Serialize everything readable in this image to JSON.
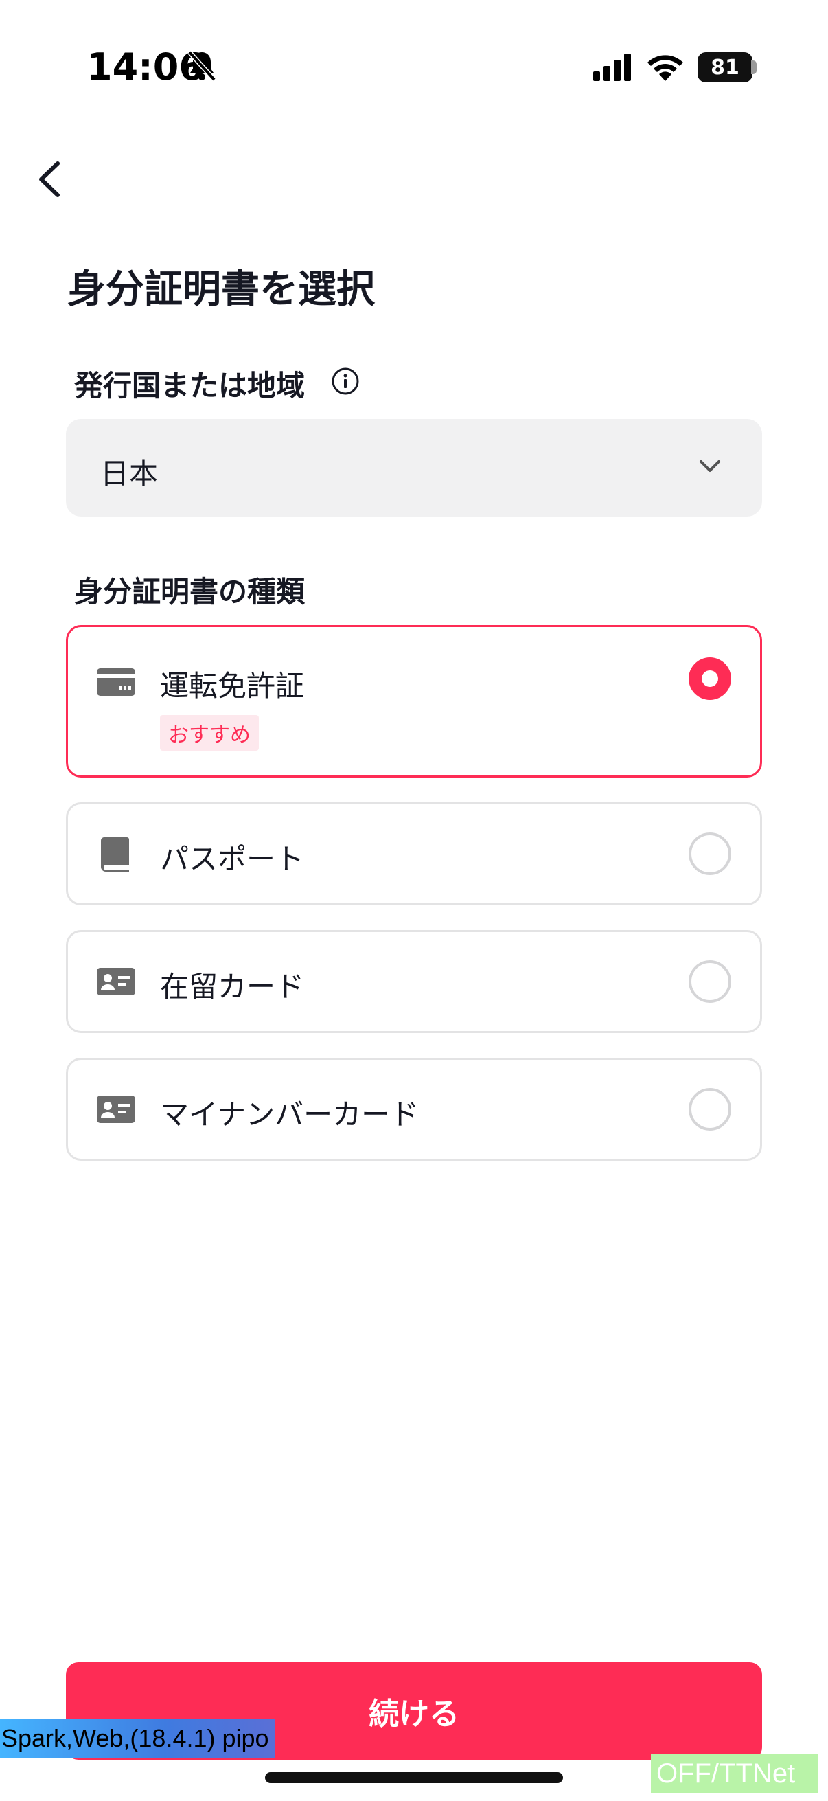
{
  "status_bar": {
    "time": "14:06",
    "battery": "81"
  },
  "page": {
    "title": "身分証明書を選択"
  },
  "country": {
    "label": "発行国または地域",
    "value": "日本"
  },
  "id_type": {
    "label": "身分証明書の種類",
    "options": [
      {
        "label": "運転免許証",
        "badge": "おすすめ",
        "icon": "id-card-icon",
        "selected": true
      },
      {
        "label": "パスポート",
        "icon": "passport-book-icon",
        "selected": false
      },
      {
        "label": "在留カード",
        "icon": "residence-card-icon",
        "selected": false
      },
      {
        "label": "マイナンバーカード",
        "icon": "my-number-card-icon",
        "selected": false
      }
    ]
  },
  "actions": {
    "continue_label": "続ける"
  },
  "overlays": {
    "debug": "Spark,Web,(18.4.1) pipo",
    "network": "OFF/TTNet"
  },
  "colors": {
    "accent": "#fe2c55",
    "select_bg": "#f1f1f2",
    "card_border": "#e3e3e4"
  }
}
